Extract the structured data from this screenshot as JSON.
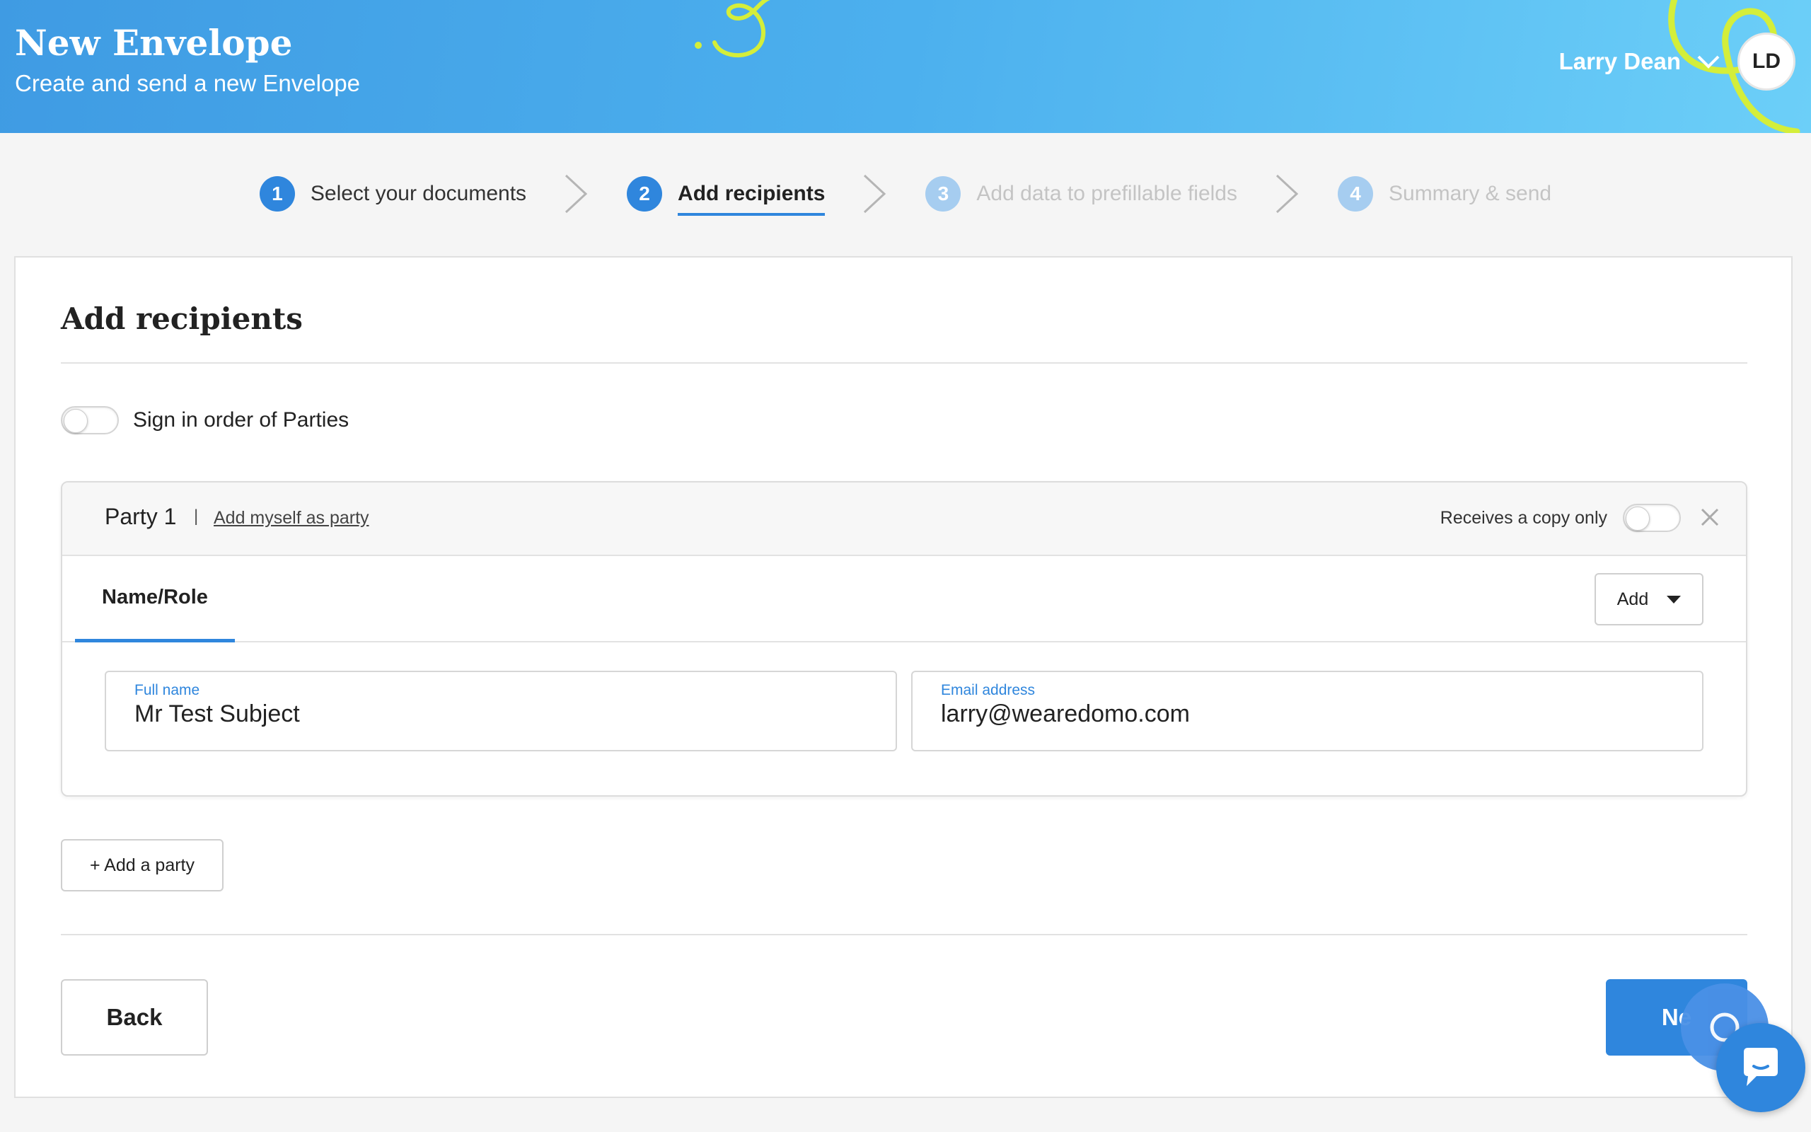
{
  "header": {
    "title": "New Envelope",
    "subtitle": "Create and send a new Envelope",
    "user_name": "Larry Dean",
    "avatar_initials": "LD"
  },
  "stepper": {
    "steps": [
      {
        "number": "1",
        "label": "Select your documents",
        "state": "done"
      },
      {
        "number": "2",
        "label": "Add recipients",
        "state": "active"
      },
      {
        "number": "3",
        "label": "Add data to prefillable fields",
        "state": "disabled"
      },
      {
        "number": "4",
        "label": "Summary & send",
        "state": "disabled"
      }
    ]
  },
  "main": {
    "title": "Add recipients",
    "sign_in_order_label": "Sign in order of Parties",
    "sign_in_order_enabled": false,
    "party": {
      "title": "Party 1",
      "separator": "|",
      "add_myself_label": "Add myself as party",
      "copy_only_label": "Receives a copy only",
      "copy_only_enabled": false,
      "tab_label": "Name/Role",
      "add_dropdown_label": "Add",
      "full_name_label": "Full name",
      "full_name_value": "Mr Test Subject",
      "email_label": "Email address",
      "email_value": "larry@wearedomo.com"
    },
    "add_party_label": "+ Add a party",
    "back_label": "Back",
    "next_label": "Ne"
  },
  "colors": {
    "accent": "#2f86dd",
    "header_gradient_start": "#3f9be3",
    "header_gradient_end": "#6ccff8",
    "swirl": "#d4ee3a"
  },
  "icons": [
    "chevron-down-icon",
    "chevron-right-icon",
    "close-icon",
    "chat-icon"
  ]
}
